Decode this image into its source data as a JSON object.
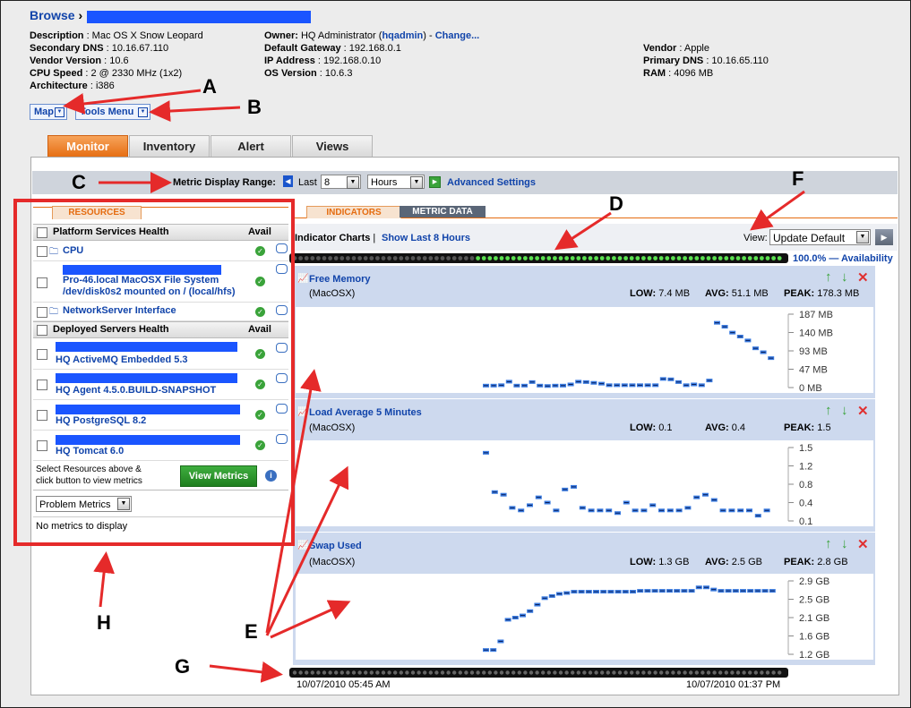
{
  "breadcrumb": {
    "browse": "Browse",
    "sep": "›"
  },
  "resource_info": {
    "col1": [
      {
        "label": "Description",
        "value": "Mac OS X Snow Leopard"
      },
      {
        "label": "Secondary DNS",
        "value": "10.16.67.110"
      },
      {
        "label": "Vendor Version",
        "value": "10.6"
      },
      {
        "label": "CPU Speed",
        "value": "2 @ 2330 MHz (1x2)"
      },
      {
        "label": "Architecture",
        "value": "i386"
      }
    ],
    "owner_label": "Owner",
    "owner_value": "HQ Administrator (",
    "owner_link": "hqadmin",
    "owner_close": ") -",
    "owner_change": "Change...",
    "col2": [
      {
        "label": "Default Gateway",
        "value": "192.168.0.1"
      },
      {
        "label": "IP Address",
        "value": "192.168.0.10"
      },
      {
        "label": "OS Version",
        "value": "10.6.3"
      }
    ],
    "col3": [
      {
        "label": "Vendor",
        "value": "Apple"
      },
      {
        "label": "Primary DNS",
        "value": "10.16.65.110"
      },
      {
        "label": "RAM",
        "value": "4096 MB"
      }
    ]
  },
  "menus": {
    "map": "Map",
    "tools": "Tools Menu"
  },
  "tabs": [
    "Monitor",
    "Inventory",
    "Alert",
    "Views"
  ],
  "range": {
    "label": "Metric Display Range:",
    "last": "Last",
    "count": "8",
    "unit": "Hours",
    "advanced": "Advanced Settings"
  },
  "resources": {
    "tab": "RESOURCES",
    "platform_header": "Platform Services Health",
    "avail": "Avail",
    "platform_items": [
      "CPU",
      "Pro-46.local MacOSX File System /dev/disk0s2 mounted on / (local/hfs)",
      "NetworkServer Interface"
    ],
    "deployed_header": "Deployed Servers Health",
    "deployed_items": [
      "HQ ActiveMQ Embedded 5.3",
      "HQ Agent 4.5.0.BUILD-SNAPSHOT",
      "HQ PostgreSQL 8.2",
      "HQ Tomcat 6.0"
    ],
    "hint": "Select Resources above & click button to view metrics",
    "view_metrics": "View Metrics",
    "problem_select": "Problem Metrics",
    "no_metrics": "No metrics to display"
  },
  "indicators": {
    "tab_indicators": "INDICATORS",
    "tab_metric_data": "METRIC DATA",
    "title": "Indicator Charts",
    "sep": "|",
    "show_last": "Show Last 8 Hours",
    "view_label": "View:",
    "view_value": "Update Default",
    "availability": "100.0% — Availability",
    "start_time": "10/07/2010 05:45 AM",
    "end_time": "10/07/2010 01:37 PM"
  },
  "charts": [
    {
      "name": "Free Memory",
      "sub": "(MacOSX)",
      "low_label": "LOW:",
      "low": "7.4 MB",
      "avg_label": "AVG:",
      "avg": "51.1 MB",
      "peak_label": "PEAK:",
      "peak": "178.3 MB",
      "ticks": [
        "187 MB",
        "140 MB",
        "93 MB",
        "47 MB",
        "0 MB"
      ]
    },
    {
      "name": "Load Average 5 Minutes",
      "sub": "(MacOSX)",
      "low_label": "LOW:",
      "low": "0.1",
      "avg_label": "AVG:",
      "avg": "0.4",
      "peak_label": "PEAK:",
      "peak": "1.5",
      "ticks": [
        "1.5",
        "1.2",
        "0.8",
        "0.4",
        "0.1"
      ]
    },
    {
      "name": "Swap Used",
      "sub": "(MacOSX)",
      "low_label": "LOW:",
      "low": "1.3 GB",
      "avg_label": "AVG:",
      "avg": "2.5 GB",
      "peak_label": "PEAK:",
      "peak": "2.8 GB",
      "ticks": [
        "2.9 GB",
        "2.5 GB",
        "2.1 GB",
        "1.6 GB",
        "1.2 GB"
      ]
    }
  ],
  "series": {
    "free_memory": [
      5,
      5,
      6,
      15,
      5,
      5,
      14,
      5,
      4,
      5,
      5,
      8,
      15,
      14,
      12,
      10,
      6,
      6,
      6,
      6,
      6,
      6,
      6,
      22,
      21,
      14,
      6,
      8,
      6,
      18,
      165,
      155,
      140,
      130,
      120,
      100,
      90,
      75
    ],
    "load_avg": [
      1.4,
      0.65,
      0.6,
      0.35,
      0.3,
      0.4,
      0.55,
      0.45,
      0.3,
      0.7,
      0.75,
      0.35,
      0.3,
      0.3,
      0.3,
      0.25,
      0.45,
      0.3,
      0.3,
      0.4,
      0.3,
      0.3,
      0.3,
      0.35,
      0.55,
      0.6,
      0.5,
      0.3,
      0.3,
      0.3,
      0.3,
      0.2,
      0.3
    ],
    "swap": [
      1.3,
      1.3,
      1.5,
      2.0,
      2.05,
      2.1,
      2.2,
      2.35,
      2.5,
      2.55,
      2.6,
      2.62,
      2.65,
      2.65,
      2.65,
      2.65,
      2.65,
      2.65,
      2.65,
      2.65,
      2.65,
      2.67,
      2.67,
      2.67,
      2.67,
      2.67,
      2.67,
      2.67,
      2.67,
      2.75,
      2.75,
      2.7,
      2.67,
      2.67,
      2.67,
      2.67,
      2.67,
      2.67,
      2.67,
      2.67
    ]
  },
  "callouts": [
    "A",
    "B",
    "C",
    "D",
    "E",
    "F",
    "G",
    "H"
  ],
  "colors": {
    "accent": "#e56c10",
    "link": "#1144aa",
    "highlight": "#e52a2a",
    "panel": "#cdd9ee",
    "bar": "#3a7be0"
  }
}
